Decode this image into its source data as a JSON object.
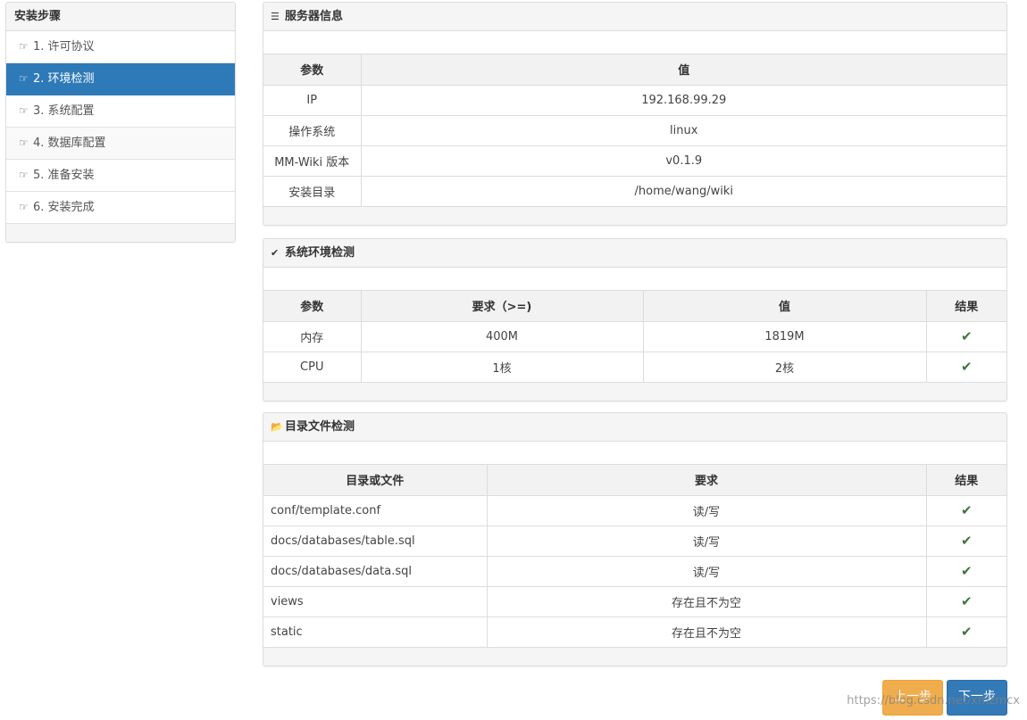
{
  "sidebar": {
    "title": "安装步骤",
    "items": [
      {
        "label": "1. 许可协议"
      },
      {
        "label": "2. 环境检测"
      },
      {
        "label": "3. 系统配置"
      },
      {
        "label": "4. 数据库配置"
      },
      {
        "label": "5. 准备安装"
      },
      {
        "label": "6. 安装完成"
      }
    ],
    "item_icon": "hand-right-icon",
    "active_index": 1
  },
  "server_info": {
    "title": "服务器信息",
    "icon": "server-icon",
    "headers": [
      "参数",
      "值"
    ],
    "rows": [
      [
        "IP",
        "192.168.99.29"
      ],
      [
        "操作系统",
        "linux"
      ],
      [
        "MM-Wiki 版本",
        "v0.1.9"
      ],
      [
        "安装目录",
        "/home/wang/wiki"
      ]
    ]
  },
  "env_check": {
    "title": "系统环境检测",
    "icon": "check-circle-icon",
    "headers": [
      "参数",
      "要求（>=)",
      "值",
      "结果"
    ],
    "rows": [
      [
        "内存",
        "400M",
        "1819M",
        "✔"
      ],
      [
        "CPU",
        "1核",
        "2核",
        "✔"
      ]
    ]
  },
  "dir_check": {
    "title": "目录文件检测",
    "icon": "folder-open-icon",
    "headers": [
      "目录或文件",
      "要求",
      "结果"
    ],
    "rows": [
      [
        "conf/template.conf",
        "读/写",
        "✔"
      ],
      [
        "docs/databases/table.sql",
        "读/写",
        "✔"
      ],
      [
        "docs/databases/data.sql",
        "读/写",
        "✔"
      ],
      [
        "views",
        "存在且不为空",
        "✔"
      ],
      [
        "static",
        "存在且不为空",
        "✔"
      ]
    ]
  },
  "buttons": {
    "prev": "上一步",
    "next": "下一步"
  },
  "watermark": "https://blog.csdn.net/xmzmcx",
  "colors": {
    "active": "#2e7ab8",
    "success": "#3c763d",
    "warning": "#f0ad4e",
    "primary": "#337ab7"
  }
}
